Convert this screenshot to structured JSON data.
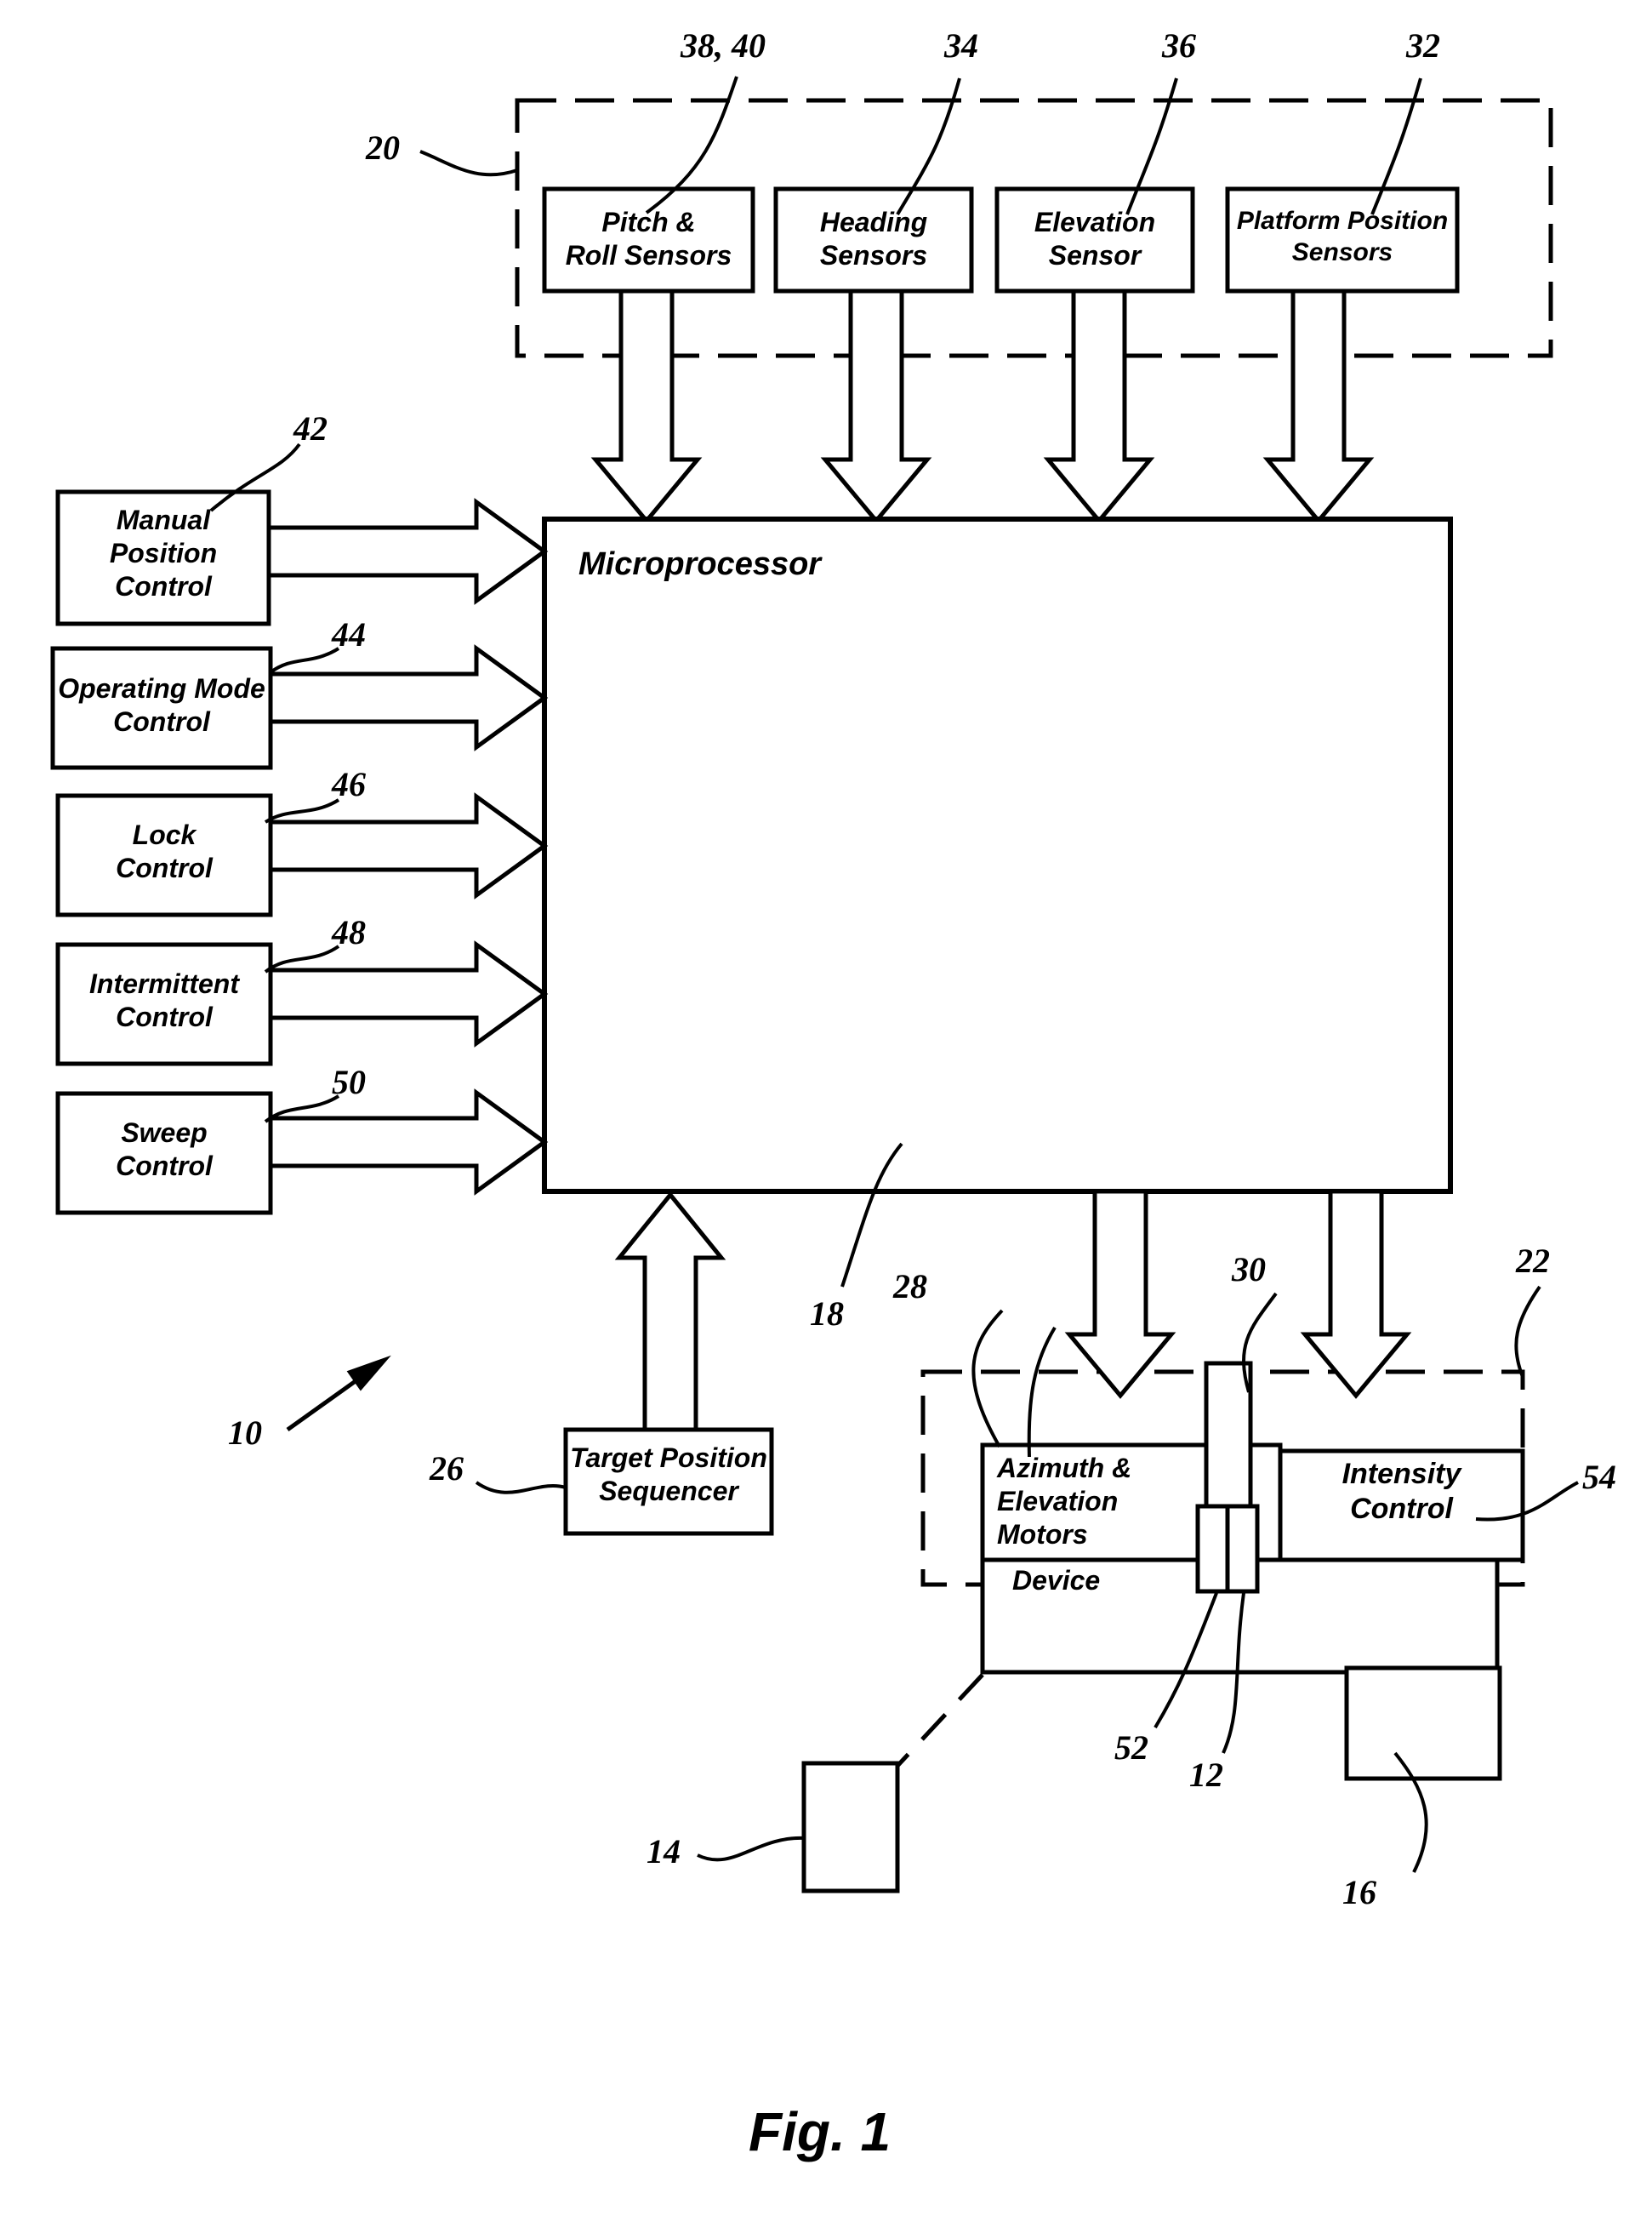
{
  "figure": {
    "caption": "Fig. 1",
    "assembly_ref": "10"
  },
  "sensor_group": {
    "ref": "20",
    "boxes": [
      {
        "label": "Pitch &\nRoll Sensors",
        "ref": "38, 40"
      },
      {
        "label": "Heading\nSensors",
        "ref": "34"
      },
      {
        "label": "Elevation\nSensor",
        "ref": "36"
      },
      {
        "label": "Platform Position\nSensors",
        "ref": "32"
      }
    ]
  },
  "controls": {
    "boxes": [
      {
        "label": "Manual\nPosition\nControl",
        "ref": "42"
      },
      {
        "label": "Operating Mode\nControl",
        "ref": "44"
      },
      {
        "label": "Lock\nControl",
        "ref": "46"
      },
      {
        "label": "Intermittent\nControl",
        "ref": "48"
      },
      {
        "label": "Sweep\nControl",
        "ref": "50"
      }
    ]
  },
  "processor": {
    "label": "Microprocessor",
    "ref": "18"
  },
  "sequencer": {
    "label": "Target Position\nSequencer",
    "ref": "26"
  },
  "output_group": {
    "ref": "22",
    "device_label": "Device",
    "device_ref": "28",
    "boxes": [
      {
        "label": "Azimuth &\nElevation\nMotors",
        "ref": ""
      },
      {
        "label": "Intensity\nControl",
        "ref": "54"
      }
    ],
    "shaft_ref": "30",
    "lower_shaft_ref": "52",
    "lamp_ref": "12",
    "target_ref": "14",
    "base_ref": "16"
  },
  "style": {
    "stroke": "#000000",
    "background": "#ffffff"
  }
}
